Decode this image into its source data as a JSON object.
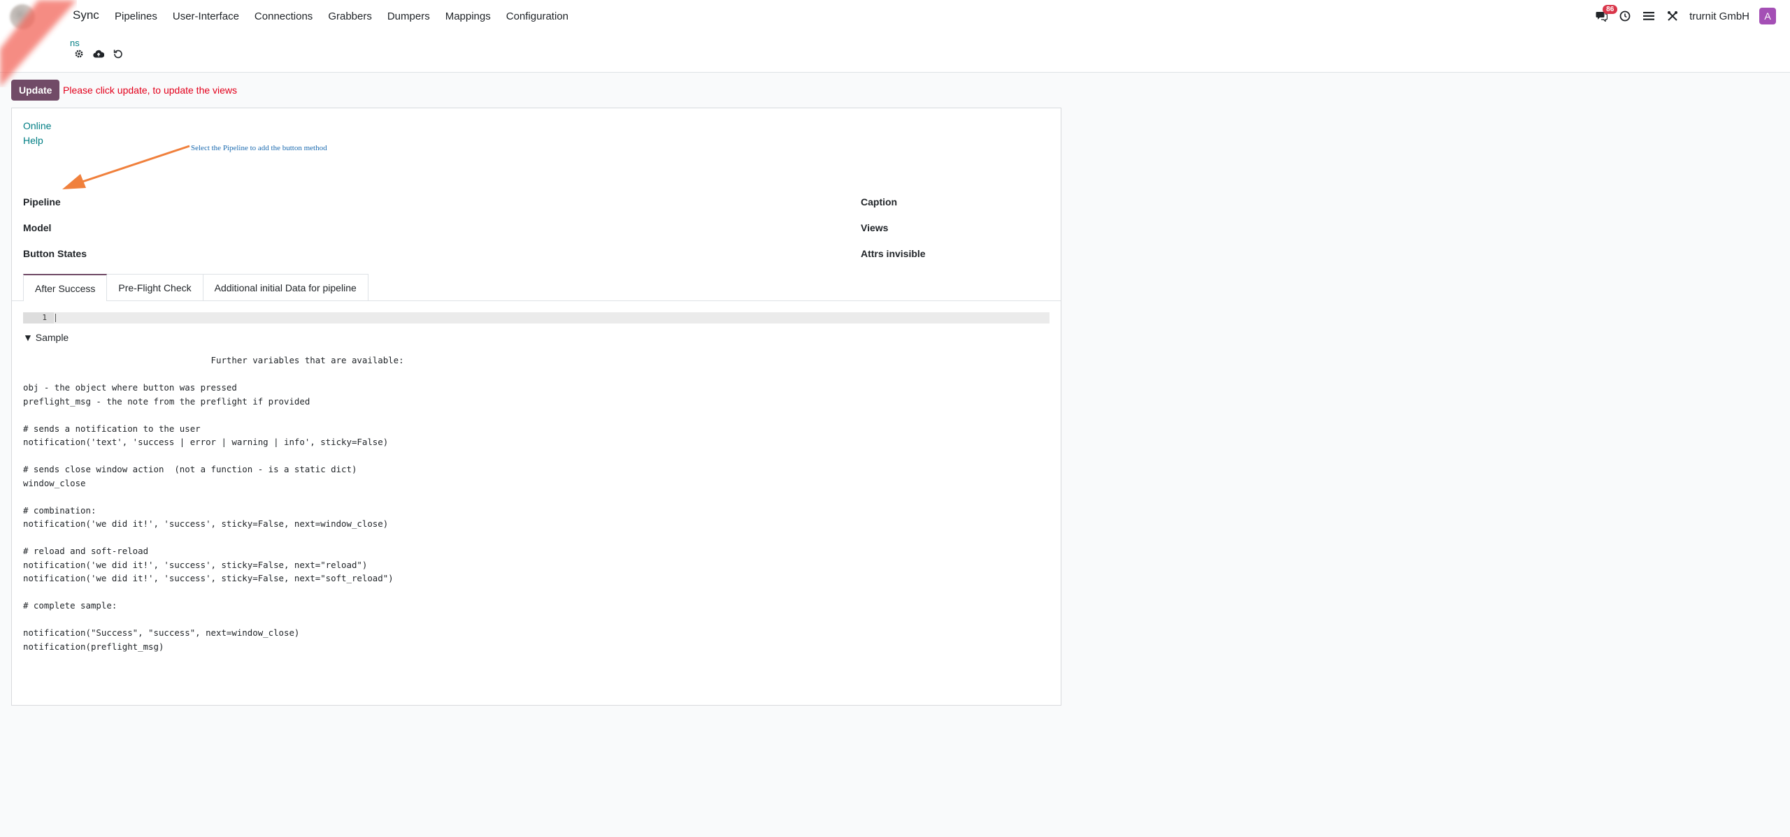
{
  "navbar": {
    "app_name": "Sync",
    "menu": [
      "Pipelines",
      "User-Interface",
      "Connections",
      "Grabbers",
      "Dumpers",
      "Mappings",
      "Configuration"
    ],
    "badge_count": "86",
    "company": "trurnit GmbH",
    "avatar_letter": "A",
    "avatar_color": "#a44fb5"
  },
  "control_panel": {
    "breadcrumb": "ns",
    "icons": [
      "gear-icon",
      "cloud-upload-icon",
      "undo-icon"
    ]
  },
  "update_bar": {
    "button_label": "Update",
    "message": "Please click update, to update the views",
    "button_color": "#714b67",
    "message_color": "#e3001b"
  },
  "form": {
    "links": [
      "Online",
      "Help"
    ],
    "hint": "Select the Pipeline to add the button method",
    "left_fields": [
      "Pipeline",
      "Model",
      "Button States"
    ],
    "right_fields": [
      "Caption",
      "Views",
      "Attrs invisible"
    ],
    "tabs": [
      "After Success",
      "Pre-Flight Check",
      "Additional initial Data for pipeline"
    ],
    "active_tab": "After Success",
    "editor_line_number": "1",
    "sample_label": "Sample",
    "sample_code": "                                    Further variables that are available:\n\nobj - the object where button was pressed\npreflight_msg - the note from the preflight if provided\n\n# sends a notification to the user\nnotification('text', 'success | error | warning | info', sticky=False)\n\n# sends close window action  (not a function - is a static dict)\nwindow_close\n\n# combination:\nnotification('we did it!', 'success', sticky=False, next=window_close)\n\n# reload and soft-reload\nnotification('we did it!', 'success', sticky=False, next=\"reload\")\nnotification('we did it!', 'success', sticky=False, next=\"soft_reload\")\n\n# complete sample:\n\nnotification(\"Success\", \"success\", next=window_close)\nnotification(preflight_msg)"
  }
}
